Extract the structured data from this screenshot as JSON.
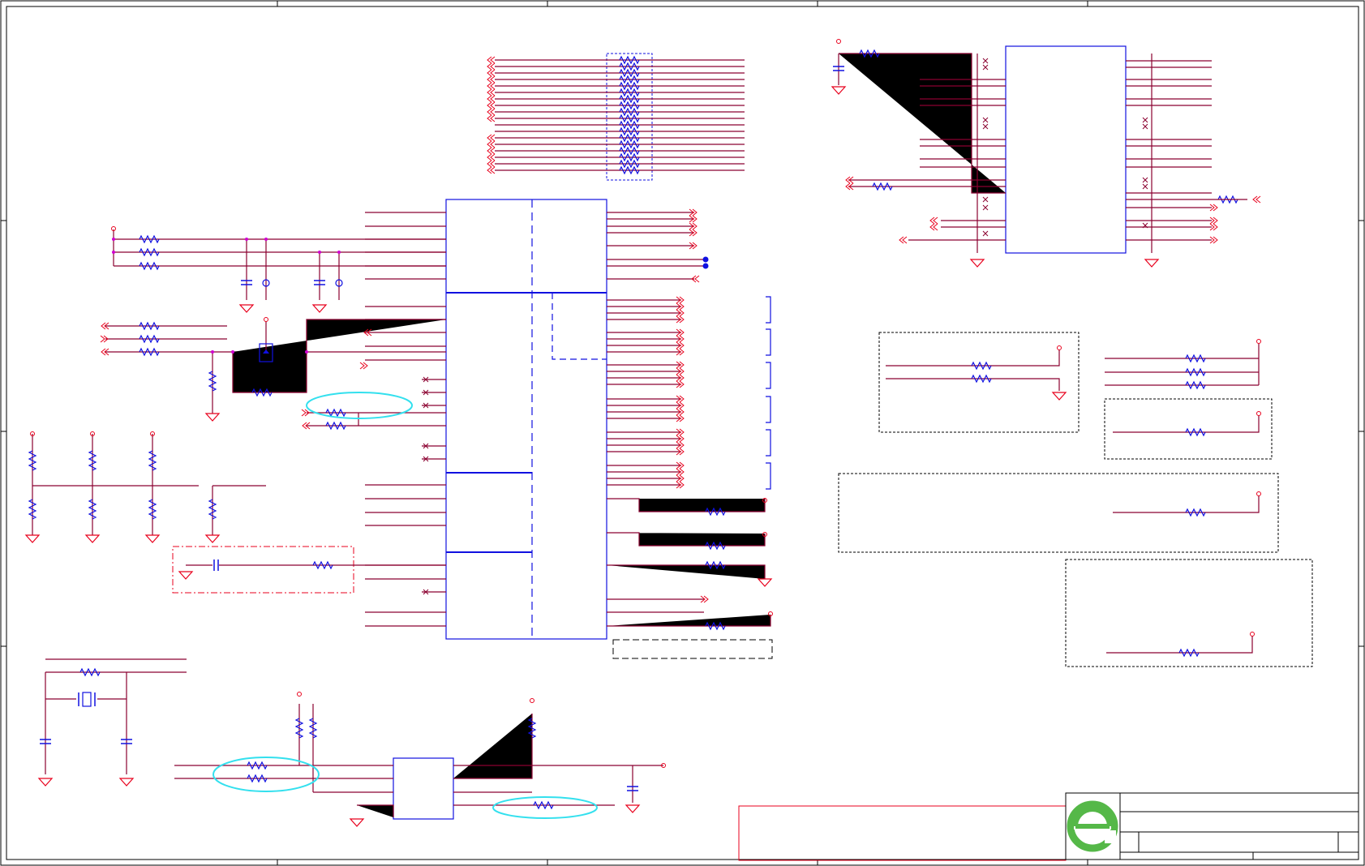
{
  "sheet": {
    "title_block": {
      "logo": "company-logo-e"
    }
  },
  "colors": {
    "wire": "#8b0030",
    "pin": "#e8001c",
    "part": "#1010e0",
    "junction": "#d000d0",
    "highlight": "#33e0ee",
    "frame": "#000000"
  }
}
